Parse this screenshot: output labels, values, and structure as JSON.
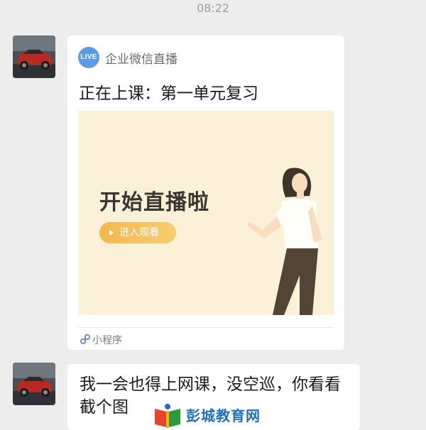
{
  "status": {
    "time": "08:22"
  },
  "messages": {
    "card": {
      "badge": "LIVE",
      "source": "企业微信直播",
      "title": "正在上课：第一单元复习",
      "cover_headline": "开始直播啦",
      "cover_button": "进入观看",
      "footer": "小程序"
    },
    "text": "我一会也得上网课，没空巡，你看看截个图"
  },
  "watermark": {
    "text": "彭城教育网"
  },
  "icons": {
    "avatar": "red-car-photo",
    "badge": "live-badge-icon",
    "button": "play-icon",
    "footer": "mini-program-icon",
    "watermark": "book-logo-icon"
  },
  "colors": {
    "background": "#ededed",
    "bubble": "#ffffff",
    "live_badge": "#5c9ae8",
    "cover_bg": "#fbf1d9",
    "cover_button": "#f2b84d",
    "watermark_text": "#1f6fbf"
  }
}
